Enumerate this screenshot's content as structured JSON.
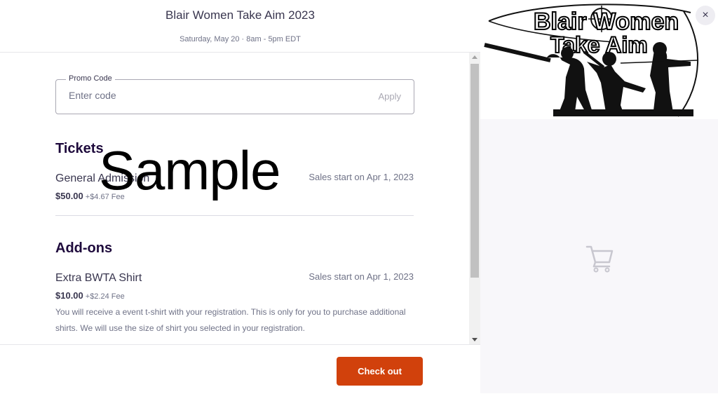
{
  "event": {
    "title": "Blair Women Take Aim 2023",
    "date": "Saturday, May 20 · 8am - 5pm EDT"
  },
  "promo": {
    "label": "Promo Code",
    "placeholder": "Enter code",
    "apply_label": "Apply"
  },
  "tickets": {
    "heading": "Tickets",
    "items": [
      {
        "name": "General Admission",
        "price": "$50.00",
        "fee": "+$4.67 Fee",
        "sales_start": "Sales start on Apr 1, 2023"
      }
    ]
  },
  "addons": {
    "heading": "Add-ons",
    "items": [
      {
        "name": "Extra BWTA Shirt",
        "price": "$10.00",
        "fee": "+$2.24 Fee",
        "sales_start": "Sales start on Apr 1, 2023",
        "description": "You will receive a event t-shirt with your registration. This is only for you to purchase additional shirts. We will use the size of shirt you selected in your registration."
      }
    ]
  },
  "watermark": "Sample",
  "footer": {
    "checkout_label": "Check out"
  },
  "banner": {
    "line1": "Blair Women",
    "line2": "Take Aim"
  },
  "close_label": "×",
  "icons": {
    "close": "close-icon",
    "cart": "cart-icon"
  },
  "colors": {
    "accent": "#d1410c",
    "heading": "#1e0a3c"
  }
}
